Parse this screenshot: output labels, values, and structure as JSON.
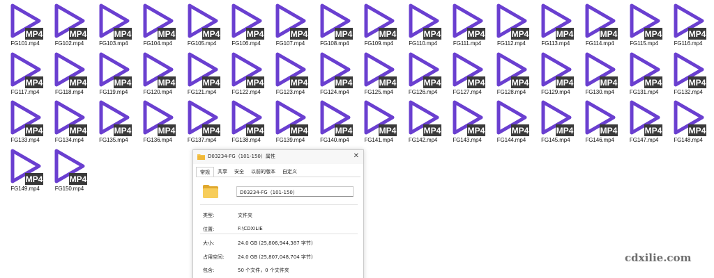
{
  "files": [
    "FG101.mp4",
    "FG102.mp4",
    "FG103.mp4",
    "FG104.mp4",
    "FG105.mp4",
    "FG106.mp4",
    "FG107.mp4",
    "FG108.mp4",
    "FG109.mp4",
    "FG110.mp4",
    "FG111.mp4",
    "FG112.mp4",
    "FG113.mp4",
    "FG114.mp4",
    "FG115.mp4",
    "FG116.mp4",
    "FG117.mp4",
    "FG118.mp4",
    "FG119.mp4",
    "FG120.mp4",
    "FG121.mp4",
    "FG122.mp4",
    "FG123.mp4",
    "FG124.mp4",
    "FG125.mp4",
    "FG126.mp4",
    "FG127.mp4",
    "FG128.mp4",
    "FG129.mp4",
    "FG130.mp4",
    "FG131.mp4",
    "FG132.mp4",
    "FG133.mp4",
    "FG134.mp4",
    "FG135.mp4",
    "FG136.mp4",
    "FG137.mp4",
    "FG138.mp4",
    "FG139.mp4",
    "FG140.mp4",
    "FG141.mp4",
    "FG142.mp4",
    "FG143.mp4",
    "FG144.mp4",
    "FG145.mp4",
    "FG146.mp4",
    "FG147.mp4",
    "FG148.mp4",
    "FG149.mp4",
    "FG150.mp4"
  ],
  "file_icon": {
    "name": "mp4-file-icon",
    "badge": "MP4",
    "play_color": "#6a3fd0",
    "badge_bg": "#3a3a3a",
    "badge_text_color": "#ffffff"
  },
  "dialog": {
    "title": "D03234-FG（101-150）属性",
    "close_glyph": "✕",
    "tabs": [
      {
        "label": "常规",
        "active": true
      },
      {
        "label": "共享",
        "active": false
      },
      {
        "label": "安全",
        "active": false
      },
      {
        "label": "以前的版本",
        "active": false
      },
      {
        "label": "自定义",
        "active": false
      }
    ],
    "folder_name": "D03234-FG（101-150）",
    "rows": [
      {
        "label": "类型:",
        "value": "文件夹"
      },
      {
        "label": "位置:",
        "value": "F:\\CDXILIE"
      },
      {
        "label": "大小:",
        "value": "24.0 GB (25,806,944,387 字节)"
      },
      {
        "label": "占用空间:",
        "value": "24.0 GB (25,807,048,704 字节)"
      },
      {
        "label": "包含:",
        "value": "50 个文件，0 个文件夹"
      }
    ]
  },
  "watermark": "cdxilie.com",
  "colors": {
    "folder_yellow": "#f5c54a",
    "folder_yellow_dark": "#e0a82e"
  }
}
